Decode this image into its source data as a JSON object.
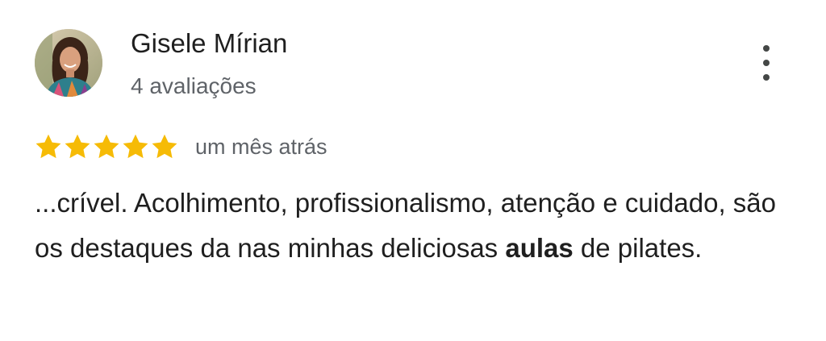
{
  "review": {
    "author_name": "Gisele Mírian",
    "author_subtitle": "4 avaliações",
    "rating": 5,
    "rating_max": 5,
    "star_color": "#f6bb06",
    "time_ago": "um mês atrás",
    "text_parts": {
      "part1": "...crível. Acolhimento, profissionalismo, atenção e cuidado, são os destaques da nas minhas deliciosas ",
      "highlight": "aulas",
      "part2": " de pilates."
    },
    "menu_icon": "more-vertical-icon"
  }
}
